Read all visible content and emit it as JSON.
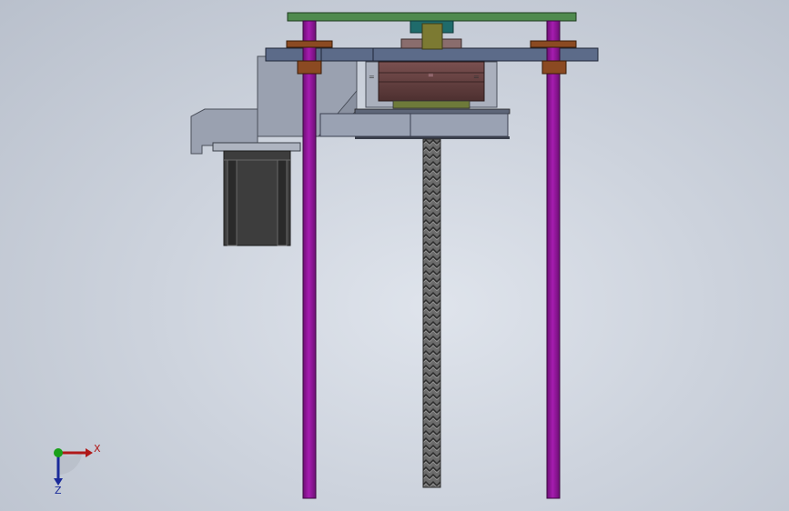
{
  "viewport": {
    "background_top": "#d6dbe3",
    "background_bottom": "#bcc3ce"
  },
  "colors": {
    "rod": "#9a17a3",
    "plate_top": "#4f8a4e",
    "plate_mid": "#5f6f8c",
    "bushing": "#8b4a22",
    "motor_block": "#6a4545",
    "coupler": "#1f6b6b",
    "shaft_olive": "#7c7a32",
    "leadscrew": "#5a5a5a",
    "bracket": "#9098a8",
    "stepper_body": "#3c3c3c"
  },
  "triad": {
    "x_label": "X",
    "z_label": "Z",
    "x_color": "#b01818",
    "z_color": "#1a2a9a",
    "y_color": "#19a019"
  }
}
